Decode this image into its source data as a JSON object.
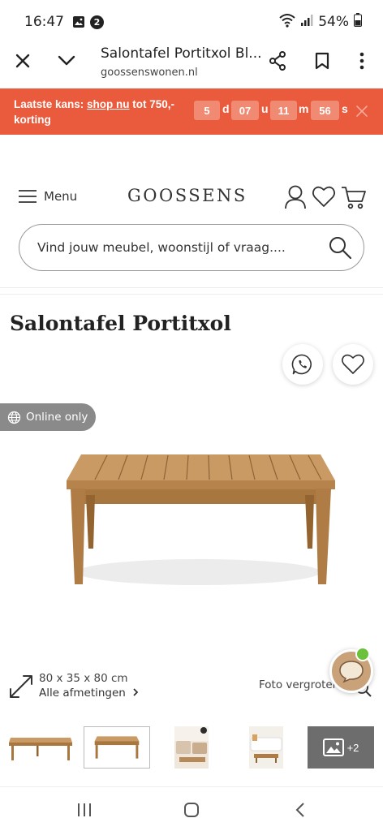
{
  "status_bar": {
    "time": "16:47",
    "notification_count": "2",
    "battery": "54%",
    "icons": [
      "gallery-icon",
      "badge-icon",
      "wifi-icon",
      "signal-icon",
      "battery-icon"
    ]
  },
  "browser": {
    "page_title": "Salontafel Portitxol Bl...",
    "url": "goossenswonen.nl",
    "icons": [
      "close-icon",
      "chevron-down-icon",
      "share-icon",
      "bookmark-icon",
      "more-vert-icon"
    ]
  },
  "promo": {
    "prefix": "Laatste kans: ",
    "link": "shop nu",
    "suffix": " tot 750,-",
    "line2": "korting",
    "countdown": {
      "days": "5",
      "days_unit": "d",
      "hours": "07",
      "hours_unit": "u",
      "minutes": "11",
      "minutes_unit": "m",
      "seconds": "56",
      "seconds_unit": "s"
    },
    "background": "#ea5a3c"
  },
  "header": {
    "menu_label": "Menu",
    "logo": "GOOSSENS",
    "icons": [
      "hamburger-icon",
      "user-icon",
      "heart-icon",
      "cart-icon"
    ]
  },
  "search": {
    "placeholder": "Vind jouw meubel, woonstijl of vraag...."
  },
  "product": {
    "title": "Salontafel Portitxol",
    "badge": "Online only",
    "dimensions": "80 x 35 x 80 cm",
    "dimensions_link": "Alle afmetingen",
    "zoom_label": "Foto vergroten",
    "more_photos": "+2"
  },
  "thumbnails": [
    "table-top-view",
    "table-side-view",
    "lifestyle-room",
    "lifestyle-sofa",
    "more-photos"
  ],
  "nav": {
    "icons": [
      "recent-apps-icon",
      "home-icon",
      "back-icon"
    ]
  }
}
